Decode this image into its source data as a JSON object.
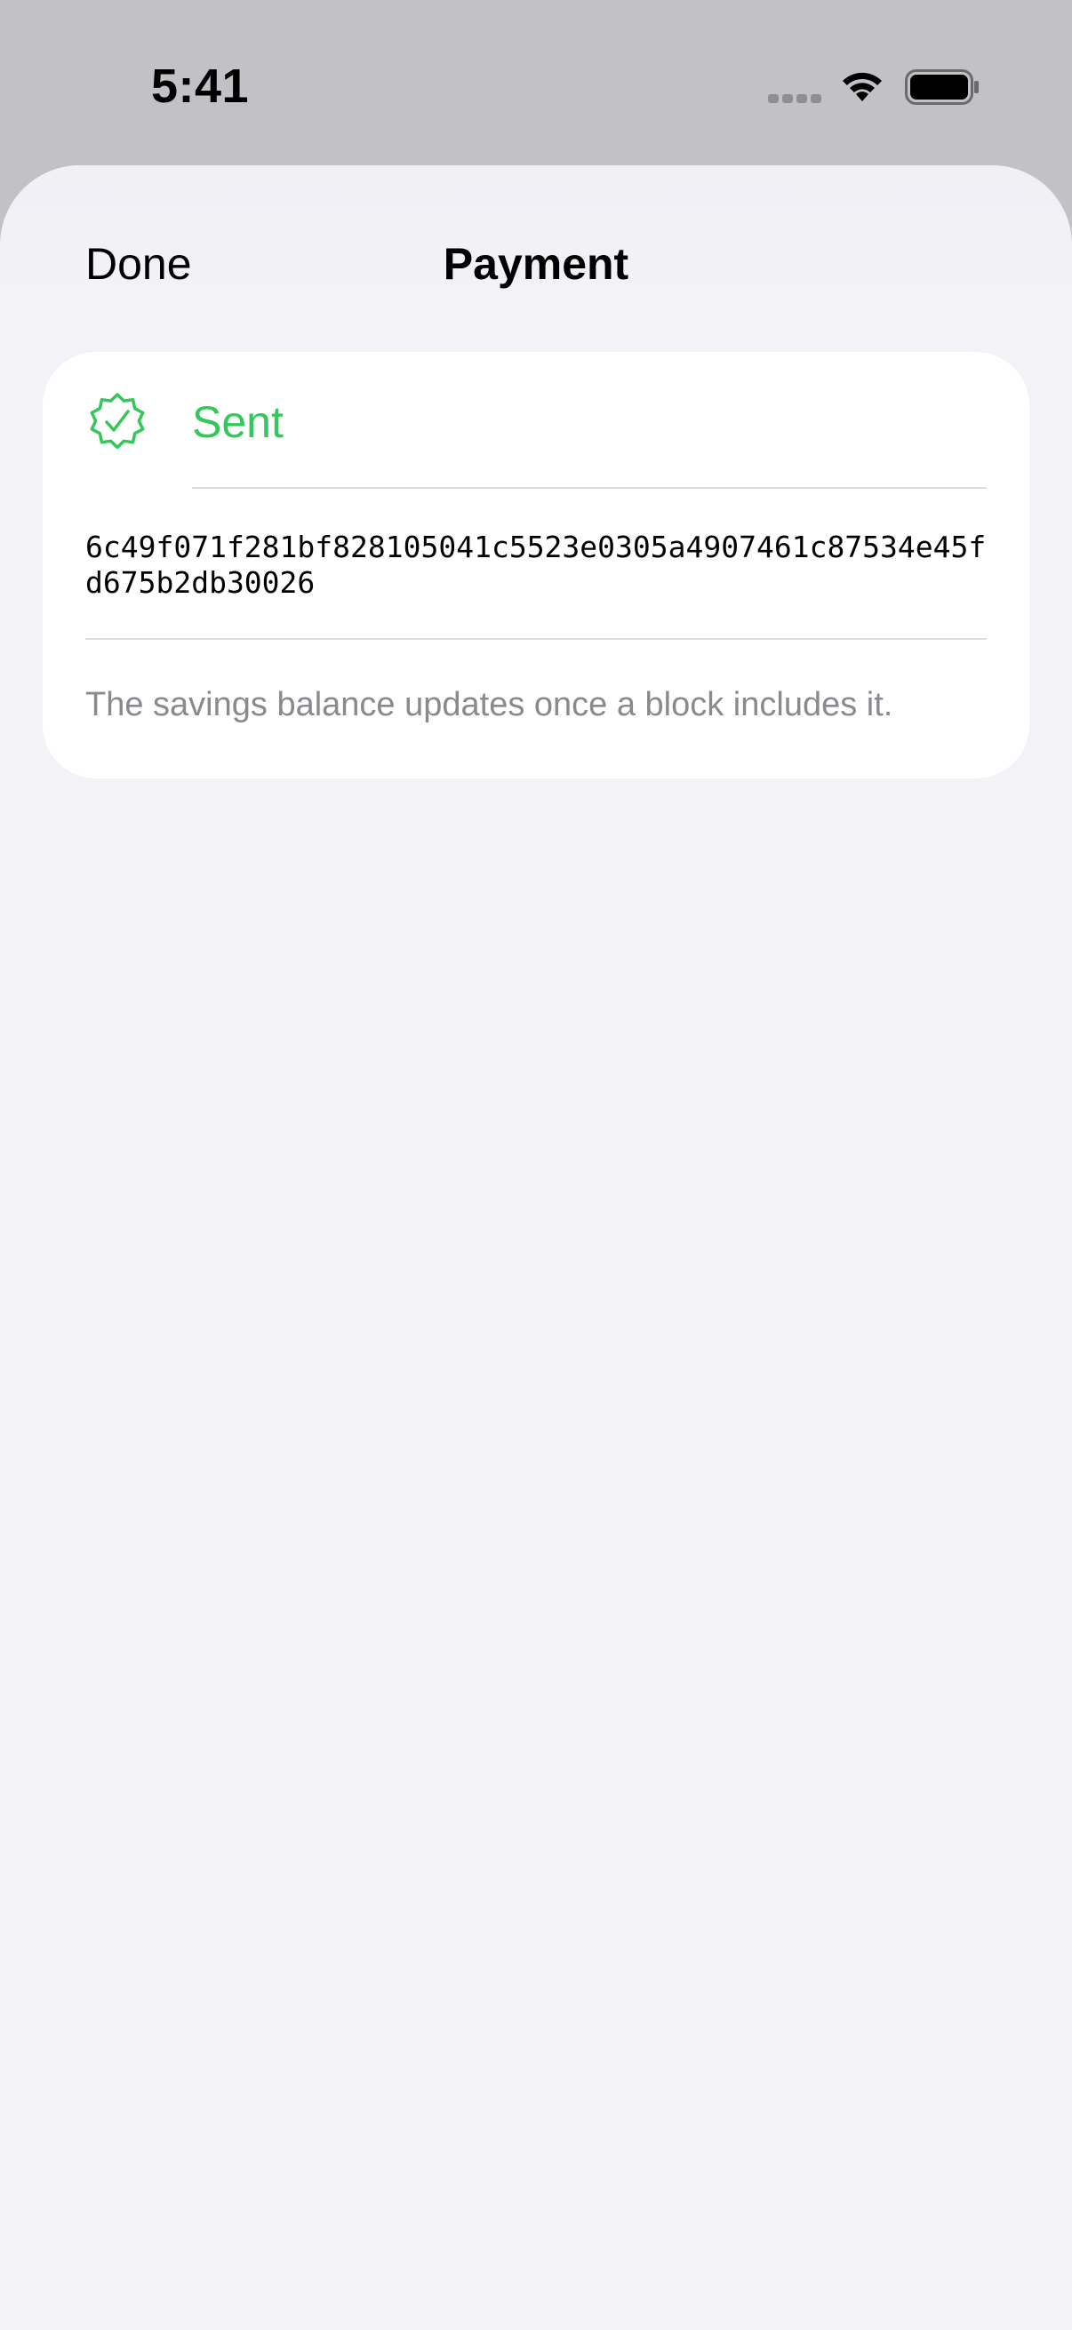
{
  "status_bar": {
    "time": "5:41",
    "icons": [
      "signal-icon",
      "wifi-icon",
      "battery-icon"
    ]
  },
  "nav": {
    "done_label": "Done",
    "title": "Payment"
  },
  "payment": {
    "status_icon": "check-badge-icon",
    "status_label": "Sent",
    "tx_hash": "6c49f071f281bf828105041c5523e0305a4907461c87534e45fd675b2db30026",
    "note": "The savings balance updates once a block includes it."
  },
  "colors": {
    "success": "#34c759",
    "sheet_background": "#f2f2f7",
    "backdrop": "#c2c1c6",
    "secondary_text": "#8a8a8e"
  }
}
